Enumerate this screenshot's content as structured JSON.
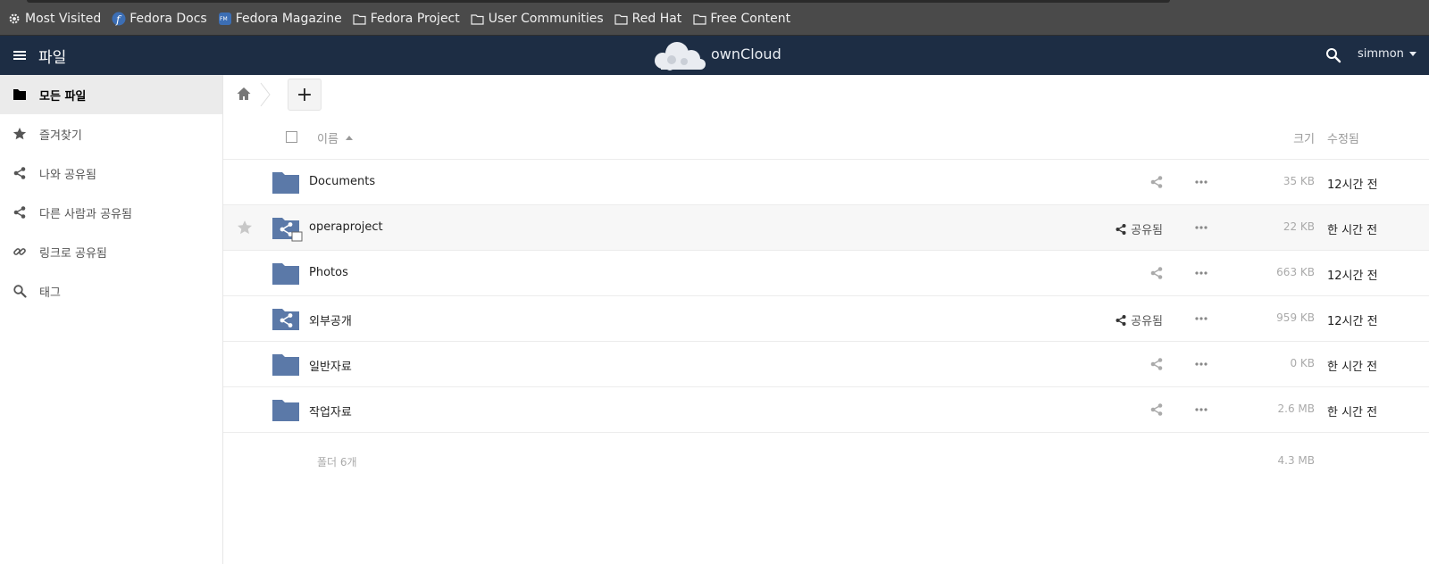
{
  "bookmarks": [
    {
      "label": "Most Visited",
      "icon": "gear-icon"
    },
    {
      "label": "Fedora Docs",
      "icon": "fedora-icon"
    },
    {
      "label": "Fedora Magazine",
      "icon": "fedora-magazine-icon"
    },
    {
      "label": "Fedora Project",
      "icon": "folder-icon"
    },
    {
      "label": "User Communities",
      "icon": "folder-icon"
    },
    {
      "label": "Red Hat",
      "icon": "folder-icon"
    },
    {
      "label": "Free Content",
      "icon": "folder-icon"
    }
  ],
  "header": {
    "app_title": "파일",
    "brand": "ownCloud",
    "user": "simmon",
    "background": "#1d2d44"
  },
  "sidebar": {
    "items": [
      {
        "label": "모든 파일",
        "icon": "folder-icon",
        "active": true
      },
      {
        "label": "즐겨찾기",
        "icon": "star-icon",
        "active": false
      },
      {
        "label": "나와 공유됨",
        "icon": "share-icon",
        "active": false
      },
      {
        "label": "다른 사람과 공유됨",
        "icon": "share-icon",
        "active": false
      },
      {
        "label": "링크로 공유됨",
        "icon": "link-icon",
        "active": false
      },
      {
        "label": "태그",
        "icon": "search-icon",
        "active": false
      }
    ]
  },
  "controls": {
    "new_label": "+"
  },
  "table": {
    "col_name": "이름",
    "col_size": "크기",
    "col_modified": "수정됨",
    "rows": [
      {
        "name": "Documents",
        "shared": false,
        "share_label": "",
        "size": "35 KB",
        "modified": "12시간 전"
      },
      {
        "name": "operaproject",
        "shared": true,
        "share_label": "공유됨",
        "size": "22 KB",
        "modified": "한 시간 전"
      },
      {
        "name": "Photos",
        "shared": false,
        "share_label": "",
        "size": "663 KB",
        "modified": "12시간 전"
      },
      {
        "name": "외부공개",
        "shared": true,
        "share_label": "공유됨",
        "size": "959 KB",
        "modified": "12시간 전"
      },
      {
        "name": "일반자료",
        "shared": false,
        "share_label": "",
        "size": "0 KB",
        "modified": "한 시간 전"
      },
      {
        "name": "작업자료",
        "shared": false,
        "share_label": "",
        "size": "2.6 MB",
        "modified": "한 시간 전"
      }
    ],
    "summary_count": "폴더 6개",
    "summary_total": "4.3 MB"
  },
  "colors": {
    "folder": "#5b79a8",
    "accent": "#1d2d44"
  }
}
